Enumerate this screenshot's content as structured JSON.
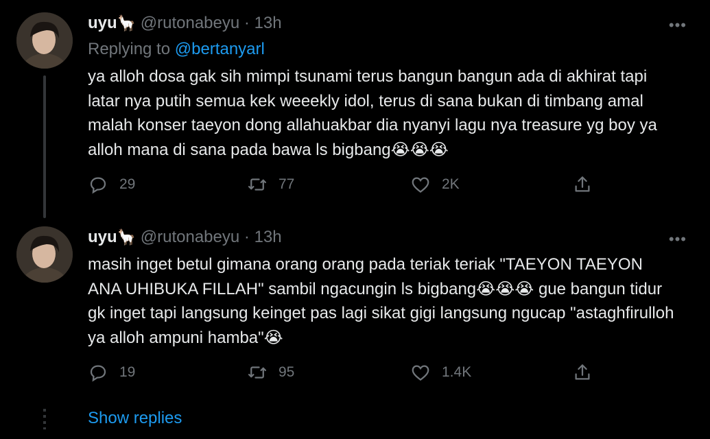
{
  "tweets": [
    {
      "name": "uyu",
      "name_emoji": "🦙",
      "handle": "@rutonabeyu",
      "separator": "·",
      "time": "13h",
      "replying_label": "Replying to ",
      "replying_to": "@bertanyarl",
      "body": "ya alloh dosa gak sih mimpi tsunami terus bangun bangun ada di akhirat tapi latar nya putih semua kek weeekly idol, terus di sana bukan di timbang amal malah konser taeyon dong allahuakbar dia nyanyi lagu nya treasure yg boy ya alloh mana di sana pada bawa ls bigbang😭😭😭",
      "replies": "29",
      "retweets": "77",
      "likes": "2K",
      "more_glyph": "•••"
    },
    {
      "name": "uyu",
      "name_emoji": "🦙",
      "handle": "@rutonabeyu",
      "separator": "·",
      "time": "13h",
      "body": "masih inget betul gimana orang orang pada teriak teriak \"TAEYON TAEYON ANA UHIBUKA FILLAH\" sambil ngacungin ls bigbang😭😭😭 gue bangun tidur gk inget tapi langsung keinget pas lagi sikat gigi langsung ngucap \"astaghfirulloh ya alloh ampuni hamba\"😭",
      "replies": "19",
      "retweets": "95",
      "likes": "1.4K",
      "more_glyph": "•••"
    }
  ],
  "show_replies": "Show replies",
  "colors": {
    "background": "#000000",
    "text": "#e7e9ea",
    "muted": "#71767b",
    "accent": "#1d9bf0"
  },
  "icons": [
    "reply-icon",
    "retweet-icon",
    "like-icon",
    "share-icon",
    "more-icon"
  ]
}
